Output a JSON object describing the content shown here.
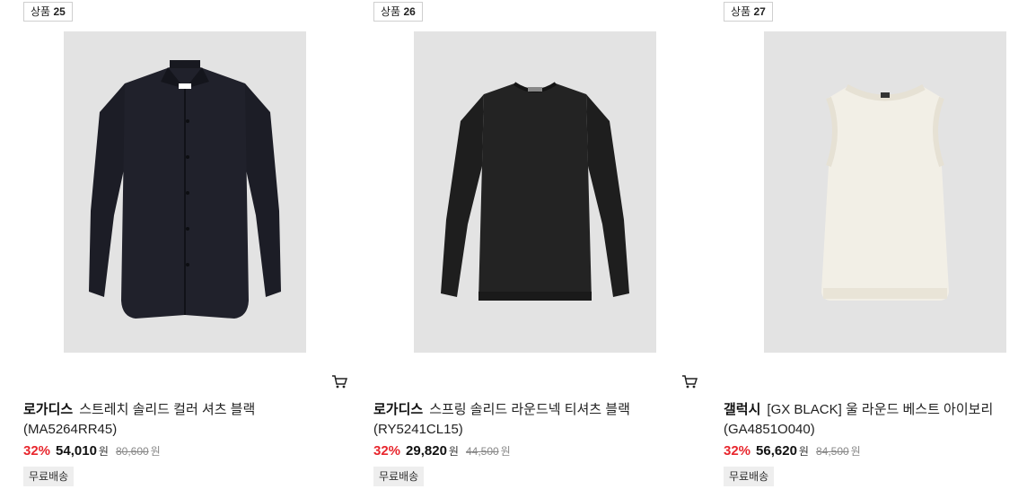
{
  "products": [
    {
      "rank_label": "상품",
      "rank_number": "25",
      "brand": "로가디스",
      "name": "스트레치 솔리드 컬러 셔츠 블랙",
      "code": "(MA5264RR45)",
      "discount": "32%",
      "sale_price": "54,010",
      "currency": "원",
      "original_price": "80,600",
      "shipping": "무료배송",
      "image": "black-dress-shirt",
      "cart_icon": "cart-icon"
    },
    {
      "rank_label": "상품",
      "rank_number": "26",
      "brand": "로가디스",
      "name": "스프링 솔리드 라운드넥 티셔츠 블랙",
      "code": "(RY5241CL15)",
      "discount": "32%",
      "sale_price": "29,820",
      "currency": "원",
      "original_price": "44,500",
      "shipping": "무료배송",
      "image": "black-long-sleeve-tee",
      "cart_icon": "cart-icon"
    },
    {
      "rank_label": "상품",
      "rank_number": "27",
      "brand": "갤럭시",
      "name": "[GX BLACK] 울 라운드 베스트 아이보리",
      "code": "(GA4851O040)",
      "discount": "32%",
      "sale_price": "56,620",
      "currency": "원",
      "original_price": "84,500",
      "shipping": "무료배송",
      "image": "ivory-knit-vest",
      "cart_icon": "cart-icon"
    }
  ],
  "colors": {
    "discount": "#e8262d",
    "image_bg": "#e3e3e3",
    "shipping_bg": "#eeeeee"
  }
}
